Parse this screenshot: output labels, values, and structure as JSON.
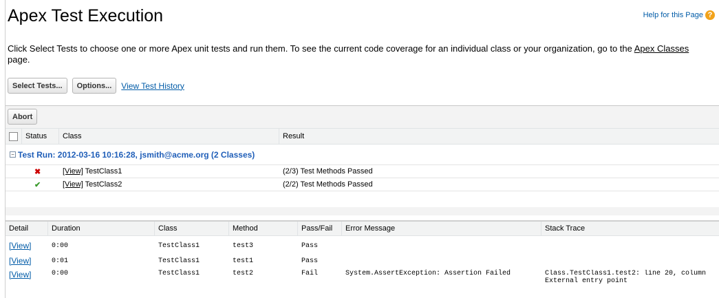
{
  "page": {
    "title": "Apex Test Execution",
    "help_label": "Help for this Page",
    "help_icon": "help-icon",
    "intro_text": "Click Select Tests to choose one or more Apex unit tests and run them. To see the current code coverage for an individual class or your organization, go to the ",
    "intro_link": "Apex Classes",
    "intro_suffix": " page."
  },
  "toolbar": {
    "select_tests": "Select Tests...",
    "options": "Options...",
    "view_history": "View Test History"
  },
  "run_panel": {
    "abort": "Abort",
    "headers": {
      "status": "Status",
      "class": "Class",
      "result": "Result"
    },
    "group_title": "Test Run: 2012-03-16 10:16:28, jsmith@acme.org (2 Classes)",
    "rows": [
      {
        "status_icon": "fail-x-icon",
        "status_glyph": "✖",
        "view": "[View]",
        "class_name": "TestClass1",
        "result": "(2/3) Test Methods Passed"
      },
      {
        "status_icon": "pass-check-icon",
        "status_glyph": "✔",
        "view": "[View]",
        "class_name": "TestClass2",
        "result": "(2/2) Test Methods Passed"
      }
    ]
  },
  "detail_table": {
    "headers": {
      "detail": "Detail",
      "duration": "Duration",
      "class": "Class",
      "method": "Method",
      "pass_fail": "Pass/Fail",
      "error": "Error Message",
      "stack": "Stack Trace"
    },
    "rows": [
      {
        "view": "[View]",
        "duration": "0:00",
        "class_name": "TestClass1",
        "method": "test3",
        "pass_fail": "Pass",
        "error": "",
        "stack1": "",
        "stack2": ""
      },
      {
        "view": "[View]",
        "duration": "0:01",
        "class_name": "TestClass1",
        "method": "test1",
        "pass_fail": "Pass",
        "error": "",
        "stack1": "",
        "stack2": ""
      },
      {
        "view": "[View]",
        "duration": "0:00",
        "class_name": "TestClass1",
        "method": "test2",
        "pass_fail": "Fail",
        "error": "System.AssertException: Assertion Failed",
        "stack1": "Class.TestClass1.test2: line 20, column",
        "stack2": "External entry point"
      }
    ]
  }
}
